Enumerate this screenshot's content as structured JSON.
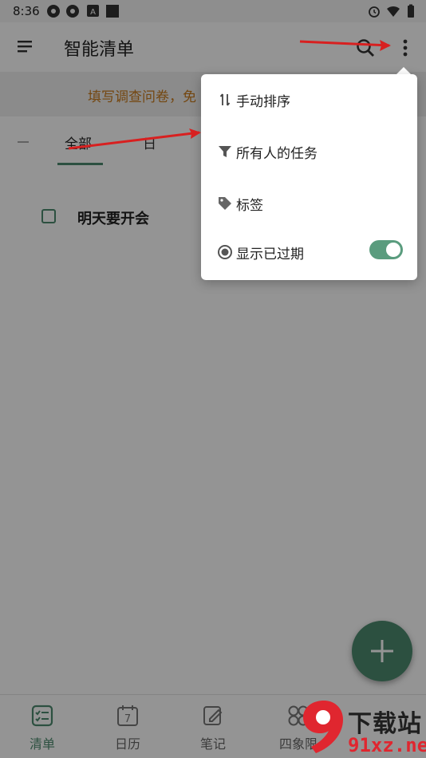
{
  "status_bar": {
    "time": "8:36"
  },
  "app_bar": {
    "title": "智能清单"
  },
  "banner": {
    "text": "填写调查问卷，免"
  },
  "tabs": {
    "all": "全部",
    "day": "日"
  },
  "tasks": [
    {
      "title": "明天要开会",
      "checked": false
    }
  ],
  "popup_menu": {
    "items": [
      {
        "label": "手动排序",
        "icon": "sort-arrows-icon"
      },
      {
        "label": "所有人的任务",
        "icon": "filter-icon"
      },
      {
        "label": "标签",
        "icon": "tag-icon"
      },
      {
        "label": "显示已过期",
        "icon": "radio-icon",
        "toggle_on": true
      }
    ]
  },
  "bottom_nav": [
    {
      "label": "清单",
      "icon": "checklist-icon",
      "active": true
    },
    {
      "label": "日历",
      "icon": "calendar-icon",
      "calendar_day": "7"
    },
    {
      "label": "笔记",
      "icon": "note-edit-icon"
    },
    {
      "label": "四象限",
      "icon": "quadrant-icon"
    }
  ],
  "watermark": {
    "line1": "下载站",
    "line2": "91xz.net"
  },
  "colors": {
    "accent": "#4d8b6f",
    "banner_text": "#c97a1d",
    "arrow": "#e0262f"
  }
}
